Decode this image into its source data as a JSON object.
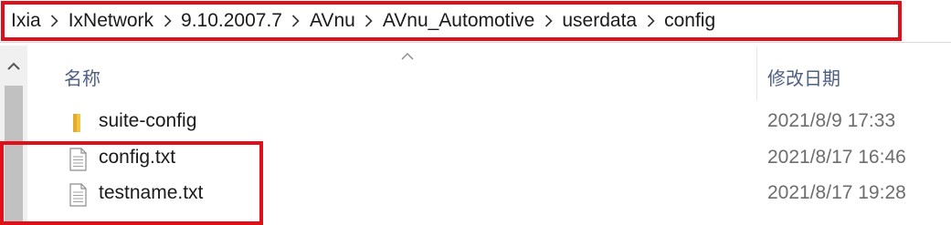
{
  "breadcrumb": [
    "Ixia",
    "IxNetwork",
    "9.10.2007.7",
    "AVnu",
    "AVnu_Automotive",
    "userdata",
    "config"
  ],
  "icons": {
    "breadcrumb_separator": "chevron-right-icon",
    "scroll_up": "chevron-up-icon",
    "sort": "sort-ascending-icon",
    "folder": "folder-icon",
    "text_file": "text-file-icon"
  },
  "columns": {
    "name": "名称",
    "date_modified": "修改日期"
  },
  "files": [
    {
      "name": "suite-config",
      "date": "2021/8/9 17:33",
      "type": "folder"
    },
    {
      "name": "config.txt",
      "date": "2021/8/17 16:46",
      "type": "text"
    },
    {
      "name": "testname.txt",
      "date": "2021/8/17 19:28",
      "type": "text"
    }
  ],
  "colors": {
    "highlight": "#e0101a",
    "header_text": "#4d6082",
    "folder": "#f3c445",
    "date_text": "#6d6d6d"
  }
}
